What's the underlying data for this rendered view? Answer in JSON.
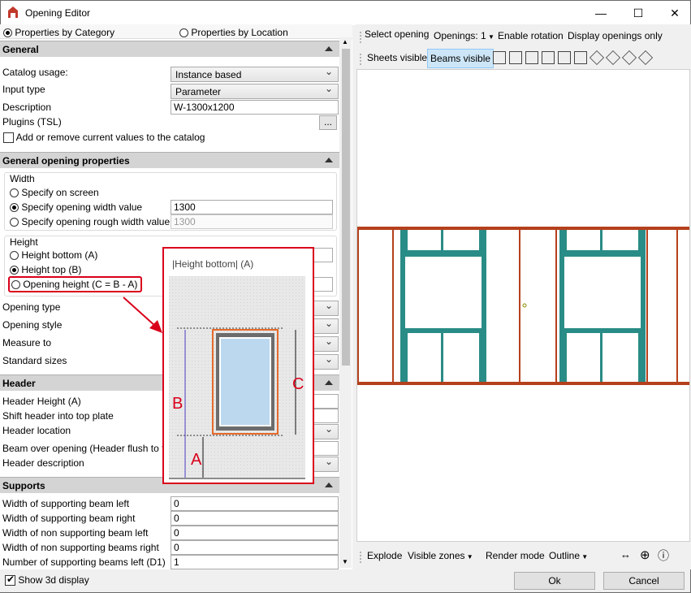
{
  "window": {
    "title": "Opening Editor",
    "minimize": "—",
    "maximize": "☐",
    "close": "✕"
  },
  "tabs": {
    "by_category": "Properties by Category",
    "by_location": "Properties by Location"
  },
  "general": {
    "header": "General",
    "catalog_usage_label": "Catalog usage:",
    "catalog_usage_value": "Instance based",
    "input_type_label": "Input type",
    "input_type_value": "Parameter",
    "description_label": "Description",
    "description_value": "W-1300x1200",
    "plugins_label": "Plugins (TSL)",
    "plugins_button": "...",
    "catalog_checkbox": "Add or remove current values to the catalog"
  },
  "opening": {
    "header": "General opening properties",
    "width_group": "Width",
    "specify_on_screen": "Specify on screen",
    "specify_width": "Specify opening width value",
    "specify_width_value": "1300",
    "specify_rough": "Specify opening rough width value",
    "specify_rough_value": "1300",
    "height_group": "Height",
    "height_bottom": "Height bottom (A)",
    "height_top": "Height top (B)",
    "opening_height": "Opening height (C = B - A)",
    "opening_type": "Opening type",
    "opening_style": "Opening style",
    "measure_to": "Measure to",
    "standard_sizes": "Standard sizes"
  },
  "header_section": {
    "header": "Header",
    "height": "Header Height (A)",
    "shift": "Shift header into top plate",
    "location": "Header location",
    "beam_over": "Beam over opening (Header flush to t",
    "description": "Header description"
  },
  "supports": {
    "header": "Supports",
    "w_left": "Width of supporting beam left",
    "w_left_v": "0",
    "w_right": "Width of supporting beam right",
    "w_right_v": "0",
    "wn_left": "Width of non supporting beam left",
    "wn_left_v": "0",
    "wn_right": "Width of non supporting beams right",
    "wn_right_v": "0",
    "num_left": "Number of supporting beams left (D1)",
    "num_left_v": "1"
  },
  "popup": {
    "title": "|Height bottom| (A)",
    "label_a": "A",
    "label_b": "B",
    "label_c": "C"
  },
  "toolbar1": {
    "select_opening": "Select opening",
    "openings": "Openings: 1",
    "enable_rotation": "Enable rotation",
    "display_only": "Display openings only"
  },
  "toolbar2": {
    "sheets_visible": "Sheets visible",
    "beams_visible": "Beams visible"
  },
  "toolbar3": {
    "explode": "Explode",
    "visible_zones": "Visible zones",
    "render_mode": "Render mode",
    "render_value": "Outline"
  },
  "footer": {
    "show_3d": "Show 3d display",
    "ok": "Ok",
    "cancel": "Cancel"
  }
}
